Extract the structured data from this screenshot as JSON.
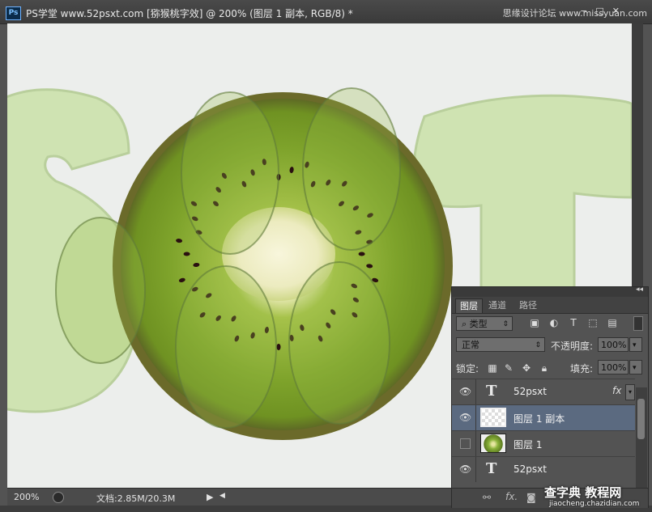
{
  "window": {
    "title": "PS学堂 www.52psxt.com [猕猴桃字效] @ 200% (图层 1 副本, RGB/8) *",
    "app_icon": "Ps",
    "controls": [
      "−",
      "□",
      "✕"
    ],
    "watermark": "思缘设计论坛 www.missyuan.com"
  },
  "canvas": {
    "letters": [
      "S",
      "T"
    ],
    "letter_color": "#cfe3b2",
    "background": "#eceeec",
    "kiwi_colors": {
      "flesh": "#7da32a",
      "skin": "#6b5a2b",
      "core": "#f1f0c8",
      "seeds": "#2a1010"
    }
  },
  "status": {
    "zoom": "200%",
    "doc_label": "文档:2.85M/20.3M",
    "arrow": "▶",
    "left_arrow": "◀"
  },
  "layers_panel": {
    "collapse_icon": "◂◂",
    "tabs": [
      "图层",
      "通道",
      "路径"
    ],
    "filter_label": "类型",
    "filter_icon": "search-icon",
    "blend_mode": "正常",
    "opacity_label": "不透明度:",
    "opacity_value": "100%",
    "lock_label": "锁定:",
    "fill_label": "填充:",
    "fill_value": "100%",
    "rows": [
      {
        "name": "52psxt",
        "kind": "text",
        "visible": true,
        "selected": false,
        "fx": "fx"
      },
      {
        "name": "图层 1 副本",
        "kind": "pixel-transparent",
        "visible": true,
        "selected": true,
        "fx": ""
      },
      {
        "name": "图层 1",
        "kind": "pixel-kiwi",
        "visible": false,
        "selected": false,
        "fx": ""
      },
      {
        "name": "52psxt",
        "kind": "text",
        "visible": true,
        "selected": false,
        "fx": ""
      }
    ],
    "footer_icons": [
      "link-icon",
      "fx-icon",
      "mask-icon"
    ]
  },
  "bottom_watermark": {
    "line1": "查字典 教程网",
    "line2": "jiaocheng.chazidian.com"
  }
}
